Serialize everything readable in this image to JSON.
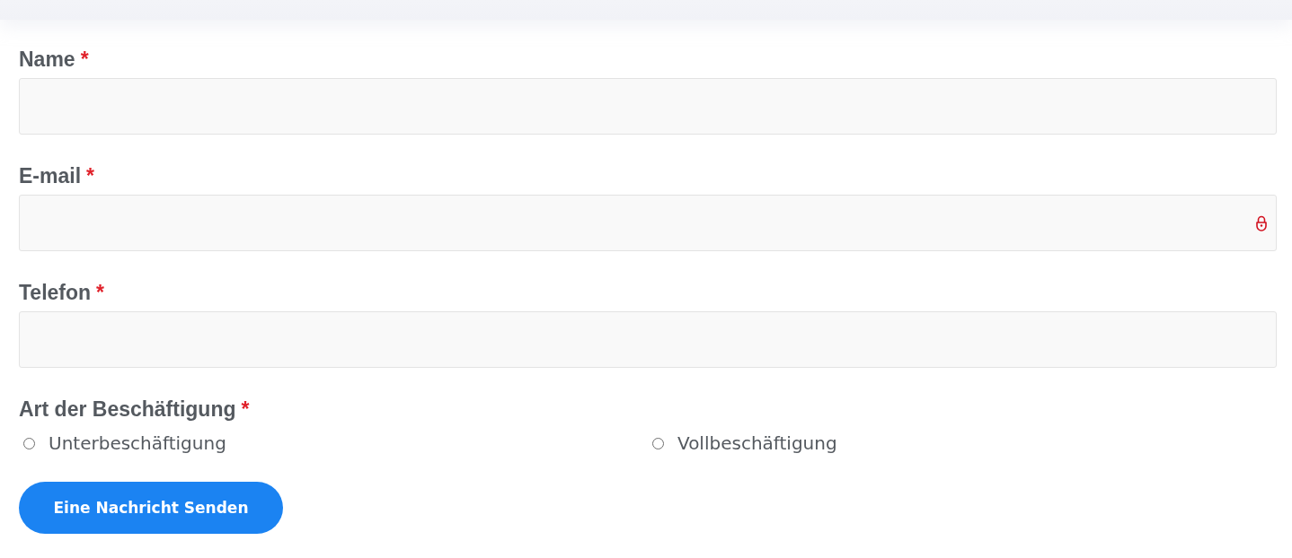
{
  "form": {
    "fields": [
      {
        "label": "Name",
        "required_mark": "*",
        "kind": "plain"
      },
      {
        "label": "E-mail",
        "required_mark": "*",
        "kind": "locked"
      },
      {
        "label": "Telefon",
        "required_mark": "*",
        "kind": "plain"
      }
    ],
    "employment": {
      "label": "Art der Beschäftigung",
      "required_mark": "*",
      "options": [
        {
          "label": "Unterbeschäftigung",
          "selected": false
        },
        {
          "label": "Vollbeschäftigung",
          "selected": false
        }
      ]
    },
    "submit_button": {
      "label": "Eine Nachricht Senden"
    }
  }
}
